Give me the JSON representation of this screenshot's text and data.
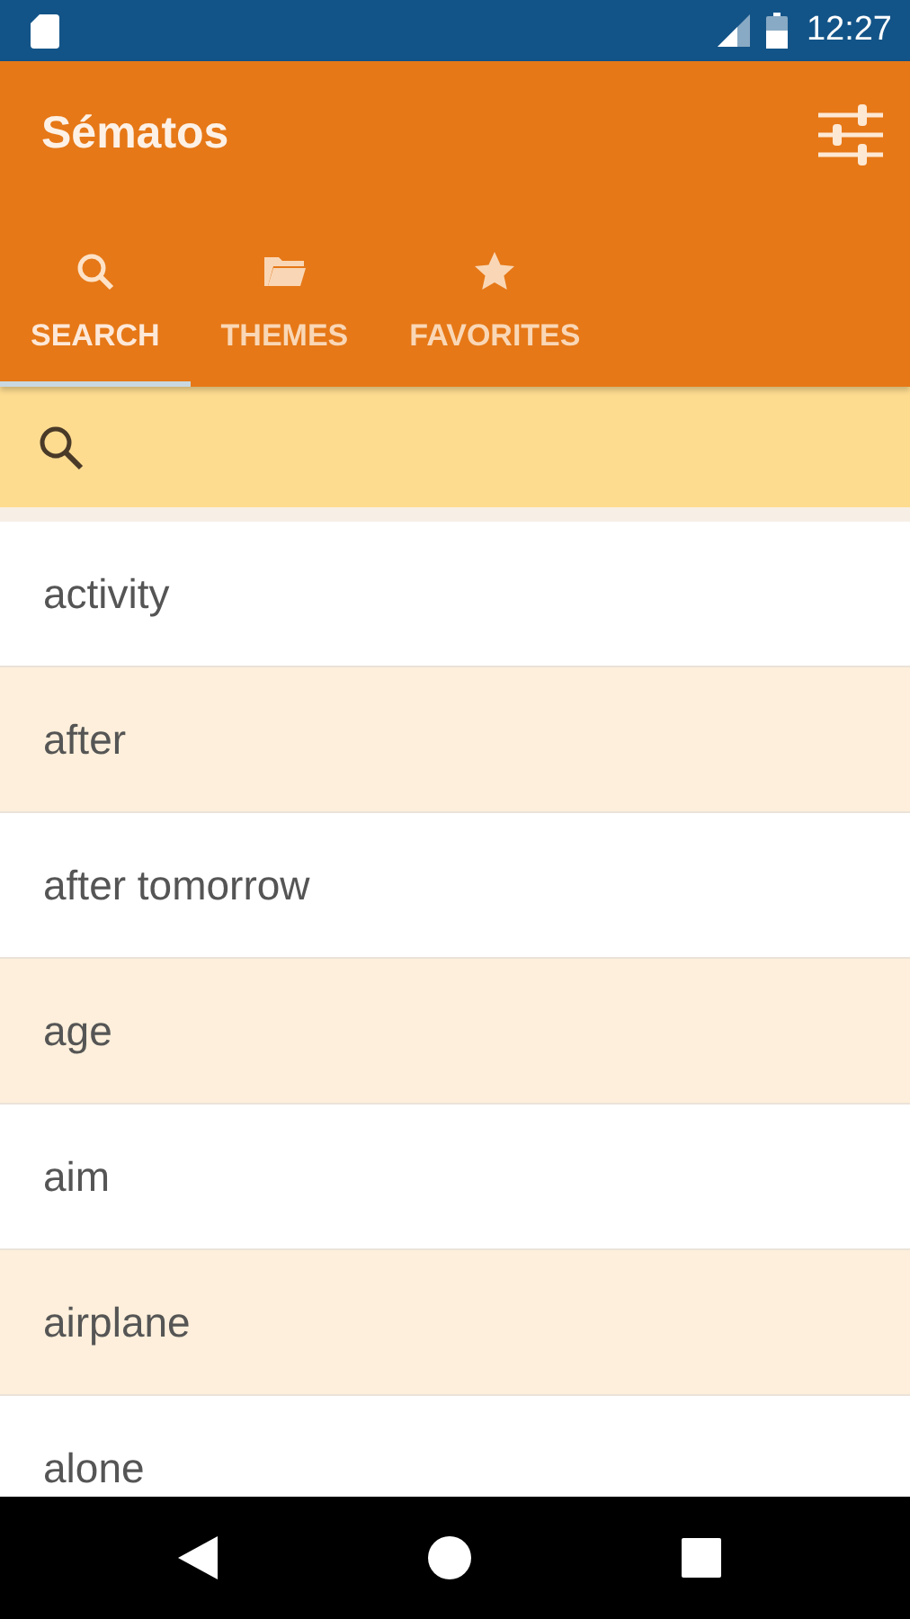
{
  "status_bar": {
    "time": "12:27"
  },
  "toolbar": {
    "title": "Sématos"
  },
  "tabs": [
    {
      "label": "SEARCH",
      "kind": "search",
      "selected": true
    },
    {
      "label": "THEMES",
      "kind": "folder",
      "selected": false
    },
    {
      "label": "FAVORITES",
      "kind": "star",
      "selected": false
    }
  ],
  "words": [
    "activity",
    "after",
    "after tomorrow",
    "age",
    "aim",
    "airplane",
    "alone"
  ]
}
